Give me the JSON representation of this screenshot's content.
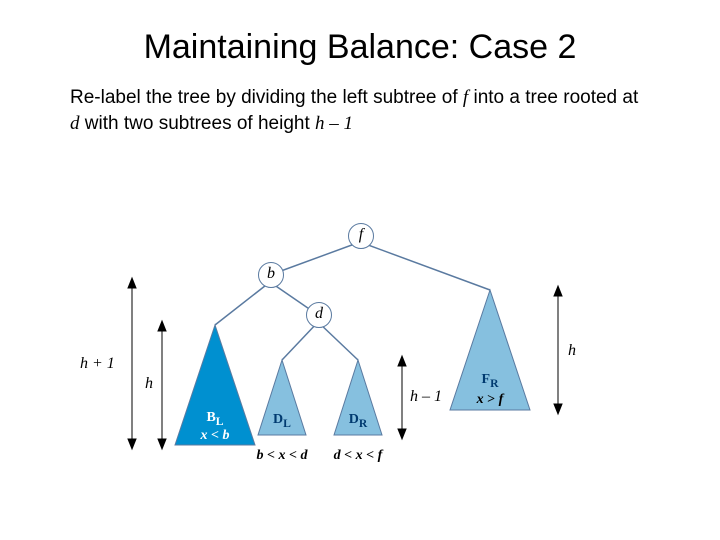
{
  "title": "Maintaining Balance: Case 2",
  "desc": {
    "p1a": "Re-label the tree by dividing the left subtree of ",
    "var_f": "f",
    "p1b": " into a tree rooted at ",
    "var_d": "d",
    "p1c": " with two subtrees of height ",
    "var_h": "h – 1"
  },
  "nodes": {
    "f": "f",
    "b": "b",
    "d": "d"
  },
  "subtrees": {
    "BL": {
      "label": "B",
      "sub": "L",
      "cond_a": "x",
      "cond_op": "<",
      "cond_b": "b"
    },
    "DL": {
      "label": "D",
      "sub": "L",
      "cond_a": "b",
      "cond_op": "<",
      "cond_mid": "x",
      "cond_op2": "<",
      "cond_b": "d"
    },
    "DR": {
      "label": "D",
      "sub": "R",
      "cond_a": "d",
      "cond_op": "<",
      "cond_mid": "x",
      "cond_op2": "<",
      "cond_b": "f"
    },
    "FR": {
      "label": "F",
      "sub": "R",
      "cond_a": "x",
      "cond_op": ">",
      "cond_b": "f"
    }
  },
  "heights": {
    "hplus1": "h + 1",
    "h_left": "h",
    "hminus1": "h – 1",
    "h_right": "h"
  }
}
